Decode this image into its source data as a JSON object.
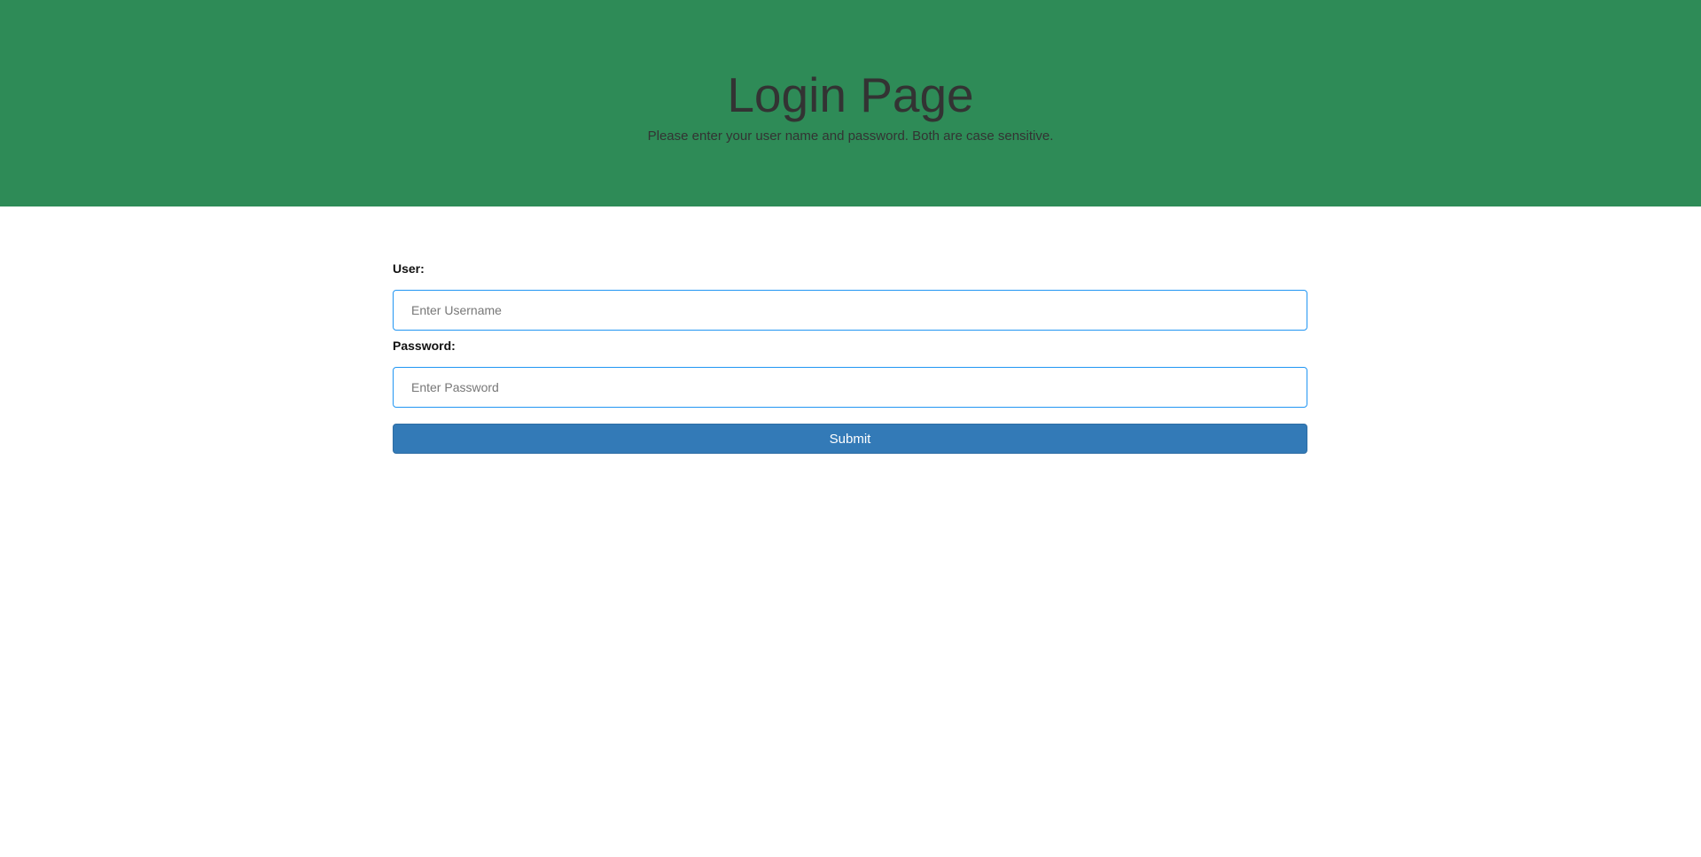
{
  "header": {
    "title": "Login Page",
    "subtitle": "Please enter your user name and password. Both are case sensitive."
  },
  "form": {
    "user_label": "User:",
    "user_placeholder": "Enter Username",
    "user_value": "",
    "password_label": "Password:",
    "password_placeholder": "Enter Password",
    "password_value": "",
    "submit_label": "Submit"
  },
  "colors": {
    "banner_background": "#2e8b57",
    "button_background": "#337ab7",
    "input_border": "#2196f3"
  }
}
